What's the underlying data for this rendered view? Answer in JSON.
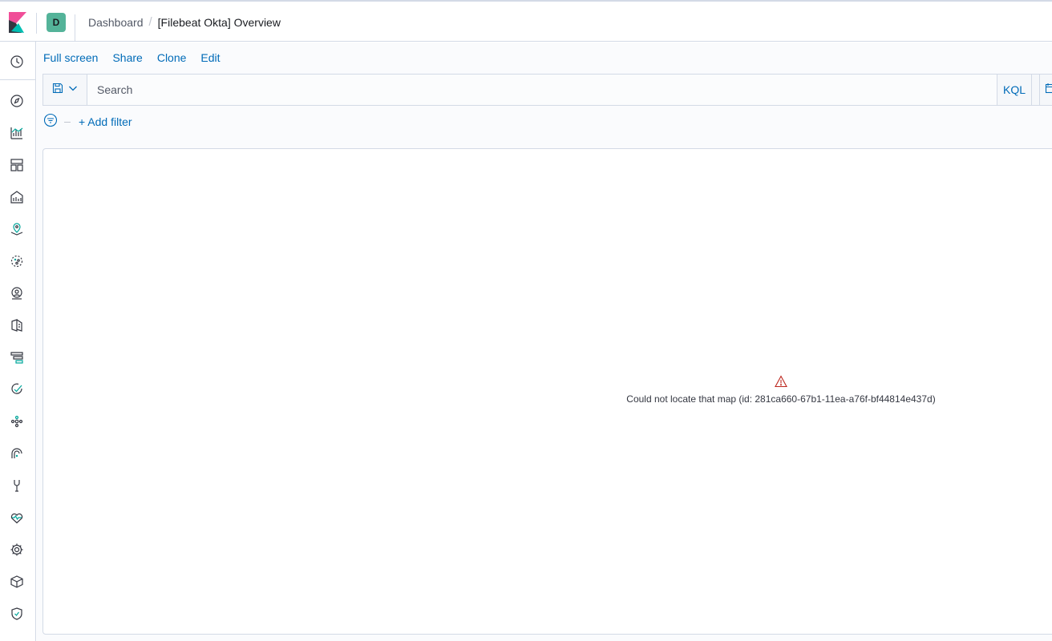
{
  "header": {
    "space_initial": "D",
    "breadcrumbs": {
      "parent": "Dashboard",
      "separator": "/",
      "current": "[Filebeat Okta] Overview"
    }
  },
  "sidenav": {
    "items": [
      {
        "icon": "clock-icon"
      },
      {
        "icon": "compass-icon"
      },
      {
        "icon": "visualize-icon"
      },
      {
        "icon": "dashboard-icon"
      },
      {
        "icon": "canvas-icon"
      },
      {
        "icon": "maps-icon"
      },
      {
        "icon": "machine-learning-icon"
      },
      {
        "icon": "metrics-icon"
      },
      {
        "icon": "logs-icon"
      },
      {
        "icon": "apm-icon"
      },
      {
        "icon": "uptime-icon"
      },
      {
        "icon": "graph-icon"
      },
      {
        "icon": "siem-icon"
      },
      {
        "icon": "dev-tools-icon"
      },
      {
        "icon": "monitoring-icon"
      },
      {
        "icon": "management-icon"
      },
      {
        "icon": "package-icon"
      },
      {
        "icon": "security-shield-icon"
      }
    ]
  },
  "toolbar": {
    "full_screen": "Full screen",
    "share": "Share",
    "clone": "Clone",
    "edit": "Edit"
  },
  "query": {
    "placeholder": "Search",
    "language": "KQL"
  },
  "filters": {
    "add_filter": "+ Add filter"
  },
  "panel": {
    "error_message": "Could not locate that map (id: 281ca660-67b1-11ea-a76f-bf44814e437d)"
  },
  "colors": {
    "accent": "#006bb8",
    "space": "#54b399",
    "danger": "#bd271e",
    "border": "#d3dae6"
  }
}
